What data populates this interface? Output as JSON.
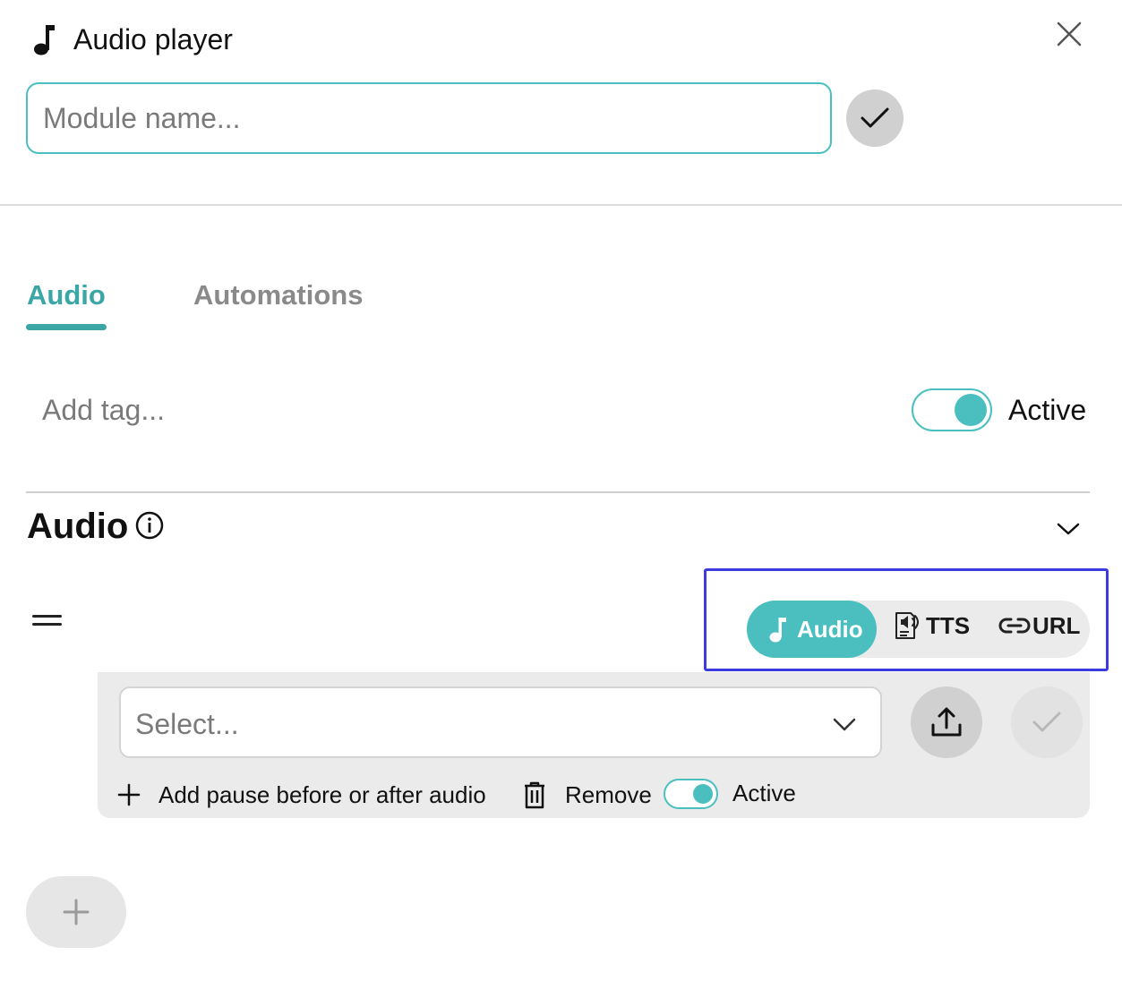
{
  "header": {
    "title": "Audio player",
    "icon": "music-note-icon",
    "close_icon": "close-icon"
  },
  "module_name": {
    "value": "",
    "placeholder": "Module name..."
  },
  "tabs": [
    {
      "label": "Audio",
      "active": true
    },
    {
      "label": "Automations",
      "active": false
    }
  ],
  "tags": {
    "placeholder": "Add tag...",
    "value": ""
  },
  "module_active": {
    "label": "Active",
    "on": true
  },
  "section": {
    "title": "Audio",
    "info_icon": "info-icon",
    "collapse_icon": "chevron-down-icon"
  },
  "source_switch": {
    "options": [
      {
        "label": "Audio",
        "icon": "music-note-icon",
        "selected": true
      },
      {
        "label": "TTS",
        "icon": "tts-icon",
        "selected": false
      },
      {
        "label": "URL",
        "icon": "link-icon",
        "selected": false
      }
    ]
  },
  "audio_item": {
    "select_value": "Select...",
    "add_pause_label": "Add pause before or after audio",
    "remove_label": "Remove",
    "active_label": "Active",
    "active_on": true
  },
  "colors": {
    "accent": "#4bbfbf",
    "tab_active": "#3aa6a6",
    "highlight": "#3b3be0",
    "card_bg": "#ebebeb"
  }
}
